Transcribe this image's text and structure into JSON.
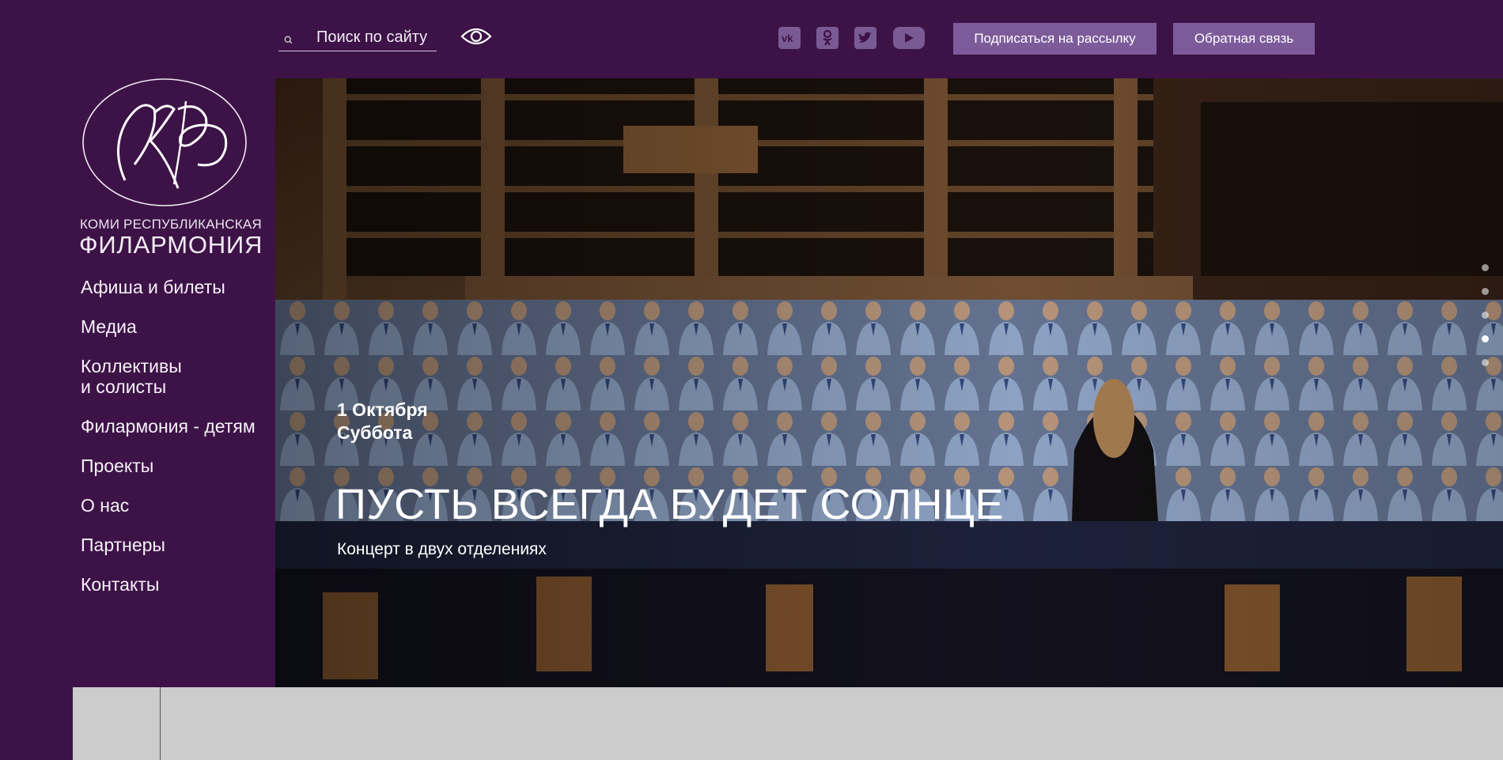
{
  "header": {
    "search": {
      "placeholder": "Поиск по сайту",
      "icon": "search-icon"
    },
    "accessibility_icon": "eye-icon",
    "social": [
      {
        "name": "vk-icon",
        "glyph": "vk"
      },
      {
        "name": "odnoklassniki-icon",
        "glyph": "ok"
      },
      {
        "name": "twitter-icon",
        "glyph": "tw"
      },
      {
        "name": "youtube-icon",
        "glyph": "yt"
      }
    ],
    "subscribe_label": "Подписаться на рассылку",
    "feedback_label": "Обратная связь"
  },
  "logo": {
    "line1": "КОМИ РЕСПУБЛИКАНСКАЯ",
    "line2": "ФИЛАРМОНИЯ"
  },
  "sidebar": {
    "items": [
      {
        "label": "Афиша и билеты"
      },
      {
        "label": "Медиа"
      },
      {
        "label": "Коллективы\nи солисты"
      },
      {
        "label": "Филармония - детям"
      },
      {
        "label": "Проекты"
      },
      {
        "label": "О нас"
      },
      {
        "label": "Партнеры"
      },
      {
        "label": "Контакты"
      }
    ]
  },
  "hero": {
    "date_line1": "1 Октября",
    "date_line2": "Суббота",
    "title": "ПУСТЬ ВСЕГДА БУДЕТ СОЛНЦЕ",
    "subtitle": "Концерт в двух отделениях",
    "slides_count": 5,
    "active_slide": 4
  },
  "colors": {
    "background": "#3d1347",
    "button": "#7d5b9a",
    "bottom_panel": "#cccccc"
  }
}
